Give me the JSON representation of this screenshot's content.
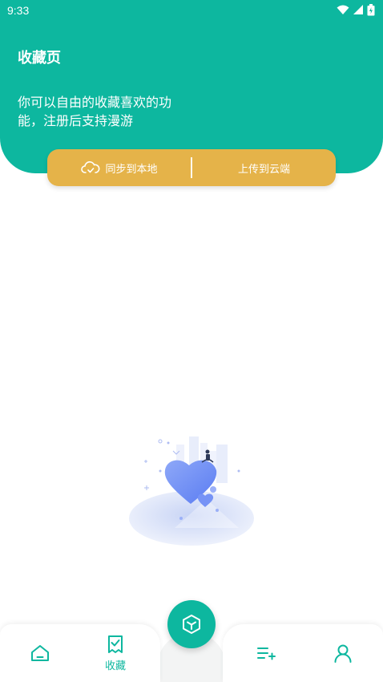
{
  "status_bar": {
    "time": "9:33",
    "icons": [
      "wifi-icon",
      "signal-icon",
      "battery-icon"
    ]
  },
  "header": {
    "title": "收藏页",
    "description": "你可以自由的收藏喜欢的功能，注册后支持漫游"
  },
  "sync_bar": {
    "left_label": "同步到本地",
    "left_icon": "cloud-sync-icon",
    "right_label": "上传到云端"
  },
  "empty_state": {
    "illustration": "heart-city-illustration"
  },
  "bottom_nav": {
    "items": [
      {
        "icon": "home-icon",
        "label": ""
      },
      {
        "icon": "favorites-icon",
        "label": "收藏",
        "active": true
      },
      {
        "icon": "playlist-add-icon",
        "label": ""
      },
      {
        "icon": "user-icon",
        "label": ""
      }
    ],
    "fab_icon": "cube-icon"
  },
  "colors": {
    "primary": "#0db79f",
    "accent": "#e5b349",
    "heart": "#6f8ff5"
  }
}
